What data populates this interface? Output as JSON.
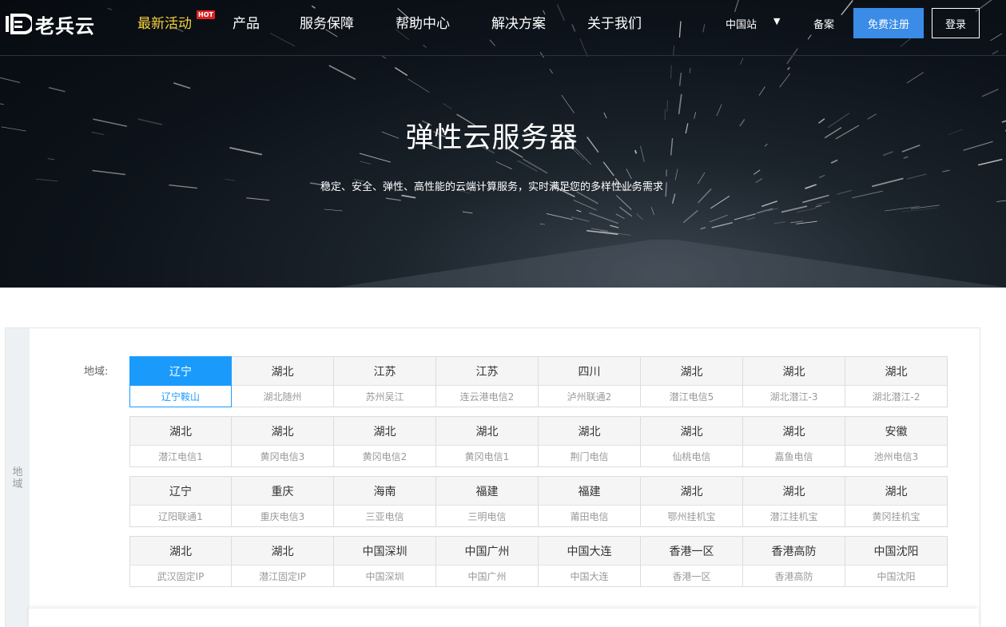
{
  "colors": {
    "accent": "#1a9bfc",
    "register_bg": "#3b8ce6",
    "active_nav": "#f5d23a",
    "hot_badge": "#e02020"
  },
  "header": {
    "logo_text": "老兵云",
    "nav": [
      {
        "label": "最新活动",
        "active": true,
        "badge": "HOT"
      },
      {
        "label": "产品"
      },
      {
        "label": "服务保障"
      },
      {
        "label": "帮助中心"
      },
      {
        "label": "解决方案"
      },
      {
        "label": "关于我们"
      }
    ],
    "site_select": "中国站",
    "site_caret_icon": "caret-down-icon",
    "beian": "备案",
    "register": "免费注册",
    "login": "登录"
  },
  "hero": {
    "title": "弹性云服务器",
    "subtitle": "稳定、安全、弹性、高性能的云端计算服务，实时满足您的多样性业务需求"
  },
  "region": {
    "side_tab": "地域",
    "label": "地域:",
    "selected": "辽宁鞍山",
    "rows": [
      [
        {
          "province": "辽宁",
          "zone": "辽宁鞍山"
        },
        {
          "province": "湖北",
          "zone": "湖北随州"
        },
        {
          "province": "江苏",
          "zone": "苏州吴江"
        },
        {
          "province": "江苏",
          "zone": "连云港电信2"
        },
        {
          "province": "四川",
          "zone": "泸州联通2"
        },
        {
          "province": "湖北",
          "zone": "潜江电信5"
        },
        {
          "province": "湖北",
          "zone": "湖北潜江-3"
        },
        {
          "province": "湖北",
          "zone": "湖北潜江-2"
        }
      ],
      [
        {
          "province": "湖北",
          "zone": "潜江电信1"
        },
        {
          "province": "湖北",
          "zone": "黄冈电信3"
        },
        {
          "province": "湖北",
          "zone": "黄冈电信2"
        },
        {
          "province": "湖北",
          "zone": "黄冈电信1"
        },
        {
          "province": "湖北",
          "zone": "荆门电信"
        },
        {
          "province": "湖北",
          "zone": "仙桃电信"
        },
        {
          "province": "湖北",
          "zone": "嘉鱼电信"
        },
        {
          "province": "安徽",
          "zone": "池州电信3"
        }
      ],
      [
        {
          "province": "辽宁",
          "zone": "辽阳联通1"
        },
        {
          "province": "重庆",
          "zone": "重庆电信3"
        },
        {
          "province": "海南",
          "zone": "三亚电信"
        },
        {
          "province": "福建",
          "zone": "三明电信"
        },
        {
          "province": "福建",
          "zone": "莆田电信"
        },
        {
          "province": "湖北",
          "zone": "鄂州挂机宝"
        },
        {
          "province": "湖北",
          "zone": "潜江挂机宝"
        },
        {
          "province": "湖北",
          "zone": "黄冈挂机宝"
        }
      ],
      [
        {
          "province": "湖北",
          "zone": "武汉固定IP"
        },
        {
          "province": "湖北",
          "zone": "潜江固定IP"
        },
        {
          "province": "中国深圳",
          "zone": "中国深圳"
        },
        {
          "province": "中国广州",
          "zone": "中国广州"
        },
        {
          "province": "中国大连",
          "zone": "中国大连"
        },
        {
          "province": "香港一区",
          "zone": "香港一区"
        },
        {
          "province": "香港高防",
          "zone": "香港高防"
        },
        {
          "province": "中国沈阳",
          "zone": "中国沈阳"
        }
      ]
    ]
  }
}
